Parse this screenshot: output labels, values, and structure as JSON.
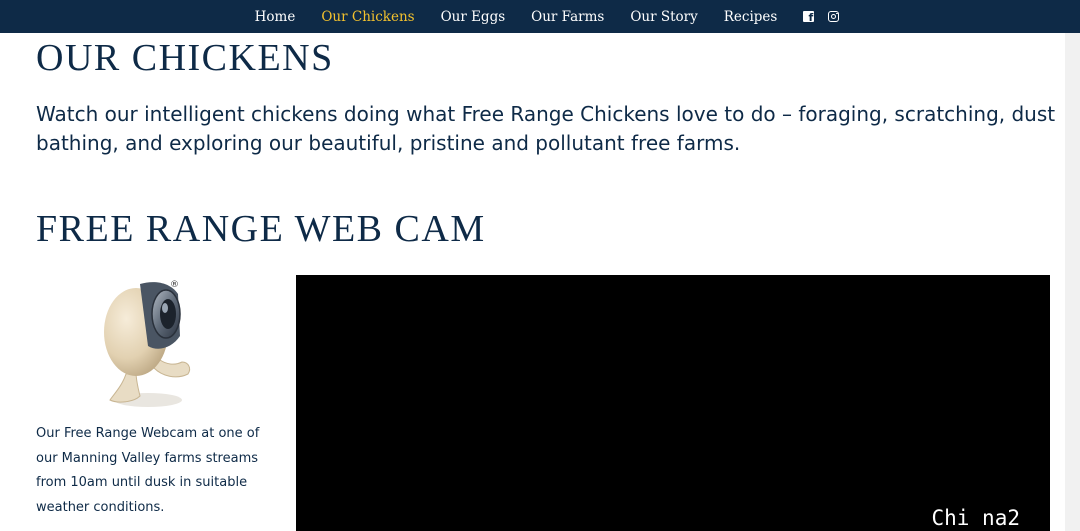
{
  "nav": {
    "items": [
      {
        "label": "Home",
        "active": false
      },
      {
        "label": "Our Chickens",
        "active": true
      },
      {
        "label": "Our Eggs",
        "active": false
      },
      {
        "label": "Our Farms",
        "active": false
      },
      {
        "label": "Our Story",
        "active": false
      },
      {
        "label": "Recipes",
        "active": false
      }
    ],
    "social": {
      "facebook_icon": "facebook-icon",
      "instagram_icon": "instagram-icon"
    },
    "colors": {
      "background": "#0e2a47",
      "active": "#f2c12e",
      "text": "#ffffff"
    }
  },
  "page": {
    "title": "OUR CHICKENS",
    "intro": "Watch our intelligent chickens doing what Free Range Chickens love to do – foraging, scratching, dust bathing, and exploring our beautiful, pristine and pollutant free farms.",
    "webcam_heading": "FREE RANGE WEB CAM",
    "webcam_description": "Our Free Range Webcam at one of our Manning Valley farms streams from 10am until dusk in suitable weather conditions.",
    "mascot_mark": "®",
    "text_color": "#0e2a47"
  },
  "video": {
    "watermark": "Chi na2",
    "background": "#000000"
  }
}
